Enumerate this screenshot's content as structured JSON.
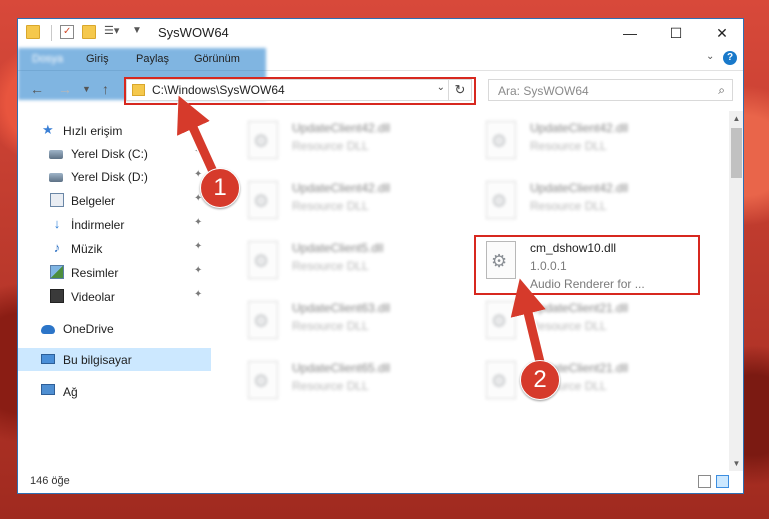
{
  "window": {
    "title": "SysWOW64",
    "controls": {
      "minimize": "—",
      "maximize": "☐",
      "close": "✕"
    }
  },
  "ribbon": {
    "tabs": [
      {
        "label": "Dosya"
      },
      {
        "label": "Giriş"
      },
      {
        "label": "Paylaş"
      },
      {
        "label": "Görünüm"
      }
    ],
    "help": "?"
  },
  "address": {
    "path": "C:\\Windows\\SysWOW64",
    "search_placeholder": "Ara: SysWOW64"
  },
  "nav": {
    "items": [
      {
        "label": "Hızlı erişim",
        "icon": "star-icon",
        "pinned": false
      },
      {
        "label": "Yerel Disk (C:)",
        "icon": "drive-icon",
        "pinned": true
      },
      {
        "label": "Yerel Disk (D:)",
        "icon": "drive-icon",
        "pinned": true
      },
      {
        "label": "Belgeler",
        "icon": "documents-icon",
        "pinned": true
      },
      {
        "label": "İndirmeler",
        "icon": "download-icon",
        "pinned": true
      },
      {
        "label": "Müzik",
        "icon": "music-icon",
        "pinned": true
      },
      {
        "label": "Resimler",
        "icon": "pictures-icon",
        "pinned": true
      },
      {
        "label": "Videolar",
        "icon": "videos-icon",
        "pinned": true
      },
      {
        "label": "OneDrive",
        "icon": "onedrive-icon",
        "pinned": false
      },
      {
        "label": "Bu bilgisayar",
        "icon": "computer-icon",
        "pinned": false,
        "selected": true
      },
      {
        "label": "Ağ",
        "icon": "network-icon",
        "pinned": false
      }
    ]
  },
  "files": [
    {
      "name": "UpdateClient42.dll",
      "line2": "Resource DLL"
    },
    {
      "name": "UpdateClient42.dll",
      "line2": "Resource DLL"
    },
    {
      "name": "UpdateClient42.dll",
      "line2": "Resource DLL"
    },
    {
      "name": "UpdateClient42.dll",
      "line2": "Resource DLL"
    },
    {
      "name": "UpdateClient5.dll",
      "line2": "Resource DLL"
    },
    {
      "name": "cm_dshow10.dll",
      "line2": "1.0.0.1",
      "line3": "Audio Renderer for ..."
    },
    {
      "name": "UpdateClient63.dll",
      "line2": "Resource DLL"
    },
    {
      "name": "UpdateClient21.dll",
      "line2": "Resource DLL"
    },
    {
      "name": "UpdateClient65.dll",
      "line2": "Resource DLL"
    },
    {
      "name": "UpdateClient21.dll",
      "line2": "Resource DLL"
    }
  ],
  "status": {
    "item_count": "146 öğe"
  },
  "annotations": {
    "badge1": "1",
    "badge2": "2"
  },
  "colors": {
    "accent": "#1979ca",
    "highlight": "#d7281f",
    "badge": "#d63a2b",
    "selection": "#cce8ff"
  }
}
